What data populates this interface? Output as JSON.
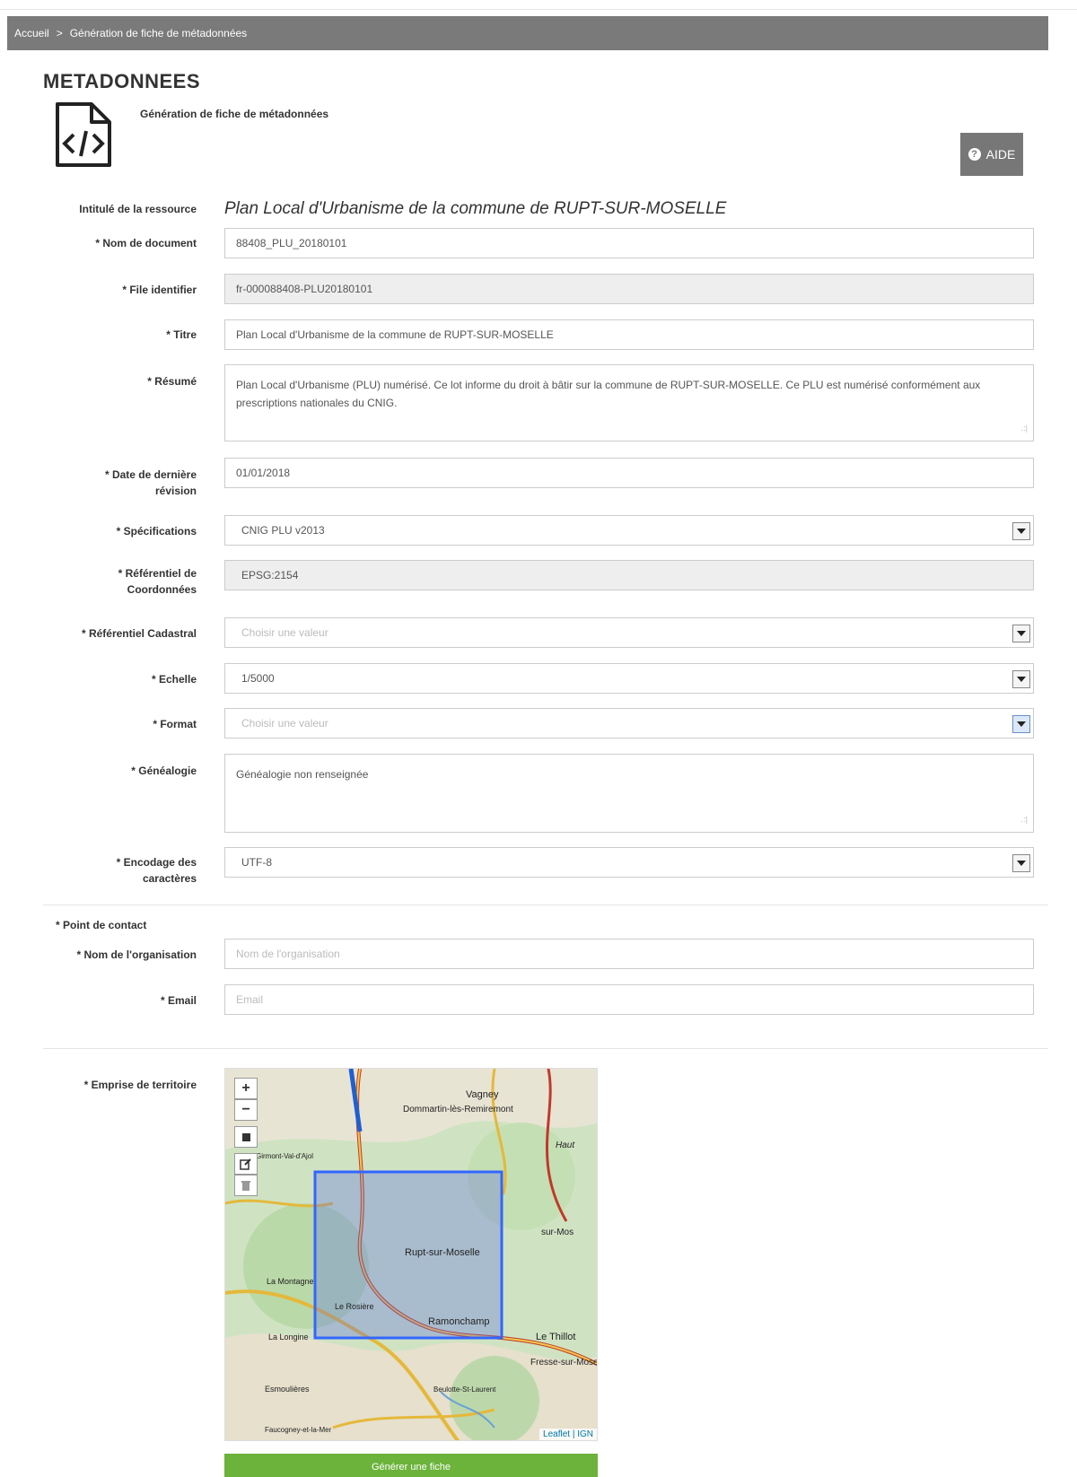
{
  "breadcrumb": {
    "home": "Accueil",
    "separator": ">",
    "current": "Génération de fiche de métadonnées"
  },
  "page": {
    "title": "METADONNEES",
    "subtitle": "Génération de fiche de métadonnées",
    "icon": "code-file-icon"
  },
  "aide_button": {
    "label": "AIDE",
    "icon": "question-circle-icon"
  },
  "form": {
    "resource_title": {
      "label": "Intitulé de la ressource",
      "value": "Plan Local d'Urbanisme de la commune de RUPT-SUR-MOSELLE"
    },
    "document_name": {
      "label": "* Nom de document",
      "value": "88408_PLU_20180101"
    },
    "file_identifier": {
      "label": "* File identifier",
      "value": "fr-000088408-PLU20180101"
    },
    "titre": {
      "label": "* Titre",
      "value": "Plan Local d'Urbanisme de la commune de RUPT-SUR-MOSELLE"
    },
    "resume": {
      "label": "* Résumé",
      "value": "Plan Local d'Urbanisme (PLU) numérisé. Ce lot informe du droit à bâtir sur la commune de RUPT-SUR-MOSELLE. Ce PLU est numérisé conformément aux prescriptions nationales du CNIG."
    },
    "revision_date": {
      "label_line1": "* Date de dernière",
      "label_line2": "révision",
      "value": "01/01/2018"
    },
    "specifications": {
      "label": "* Spécifications",
      "value": "CNIG PLU v2013"
    },
    "coord_ref": {
      "label_line1": "* Référentiel de",
      "label_line2": "Coordonnées",
      "value": "EPSG:2154"
    },
    "cadastral_ref": {
      "label": "* Référentiel Cadastral",
      "placeholder": "Choisir une valeur"
    },
    "echelle": {
      "label": "* Echelle",
      "value": "1/5000"
    },
    "format": {
      "label": "* Format",
      "placeholder": "Choisir une valeur"
    },
    "genealogie": {
      "label": "* Généalogie",
      "value": "Généalogie non renseignée"
    },
    "encoding": {
      "label_line1": "* Encodage des",
      "label_line2": "caractères",
      "value": "UTF-8"
    }
  },
  "contact": {
    "section_label": "* Point de contact",
    "organisation": {
      "label": "* Nom de l'organisation",
      "placeholder": "Nom de l'organisation"
    },
    "email": {
      "label": "* Email",
      "placeholder": "Email"
    }
  },
  "territory": {
    "label": "* Emprise de territoire",
    "map_labels": [
      "Vagney",
      "Dommartin-lès-Remiremont",
      "Rupt-sur-Moselle",
      "Ramonchamp",
      "Le Thillot",
      "Fresse-sur-Moselle",
      "Le Rosière",
      "La Longine",
      "Esmoulières",
      "Beulotte-St-Laurent",
      "Girmont-Val-d'Ajol",
      "La Montagne",
      "Faucogney-et-la-Mer",
      "Haut",
      "sur-Mos"
    ],
    "controls": {
      "zoom_in": "+",
      "zoom_out": "−"
    },
    "attribution": "Leaflet | IGN"
  },
  "generate_button": {
    "label": "Générer une fiche"
  },
  "colors": {
    "breadcrumb_bg": "#7a7a7a",
    "aide_bg": "#777777",
    "generate_bg": "#6bb33a",
    "selection_box": "#3366ff"
  }
}
